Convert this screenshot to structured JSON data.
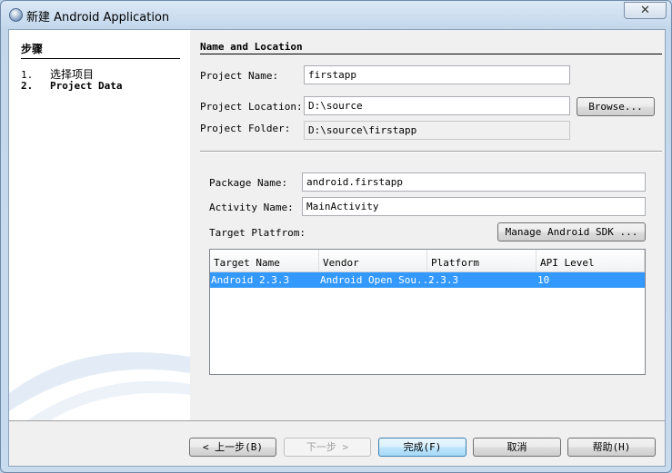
{
  "window": {
    "title": "新建 Android Application",
    "close": "✕"
  },
  "steps": {
    "heading": "步骤",
    "items": [
      {
        "num": "1.",
        "label": "选择项目"
      },
      {
        "num": "2.",
        "label": "Project Data"
      }
    ]
  },
  "section": {
    "heading": "Name and Location"
  },
  "form": {
    "project_name_label": "Project Name:",
    "project_name": "firstapp",
    "project_location_label": "Project Location:",
    "project_location": "D:\\source",
    "browse": "Browse...",
    "project_folder_label": "Project Folder:",
    "project_folder": "D:\\source\\firstapp",
    "package_name_label": "Package Name:",
    "package_name": "android.firstapp",
    "activity_name_label": "Activity Name:",
    "activity_name": "MainActivity",
    "target_platform_label": "Target Platfrom:",
    "manage_sdk": "Manage Android SDK ..."
  },
  "table": {
    "columns": [
      "Target Name",
      "Vendor",
      "Platform",
      "API Level"
    ],
    "rows": [
      [
        "Android 2.3.3",
        "Android Open Sou...",
        "2.3.3",
        "10"
      ]
    ]
  },
  "buttons": {
    "back": "< 上一步(B)",
    "next": "下一步 >",
    "finish": "完成(F)",
    "cancel": "取消",
    "help": "帮助(H)"
  },
  "colors": {
    "selection": "#3399ff"
  }
}
